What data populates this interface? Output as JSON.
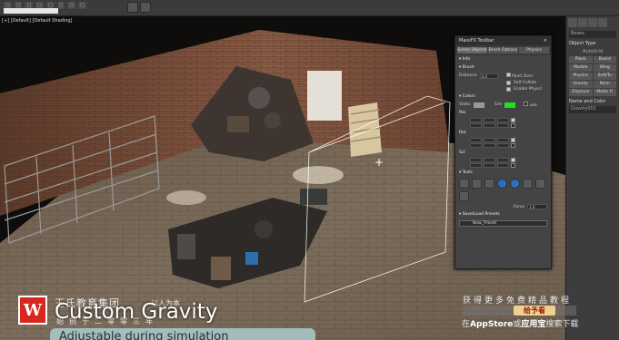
{
  "toolbar": {
    "menu_items": [
      "",
      "",
      "",
      "",
      "",
      "",
      "",
      ""
    ]
  },
  "viewport": {
    "label": "[+] [Default] [Default Shading]"
  },
  "massfx": {
    "title": "MassFX Toolbar",
    "tabs": [
      "Scene Objects",
      "Brush Options",
      "Physics"
    ],
    "sections": {
      "info": "Info",
      "brush": "Brush",
      "colors": "Colors",
      "pos": "Pos",
      "rot": "Rot",
      "scl": "Scl",
      "tools": "Tools",
      "saveload": "Save/Load Presets"
    },
    "brush": {
      "distance_label": "Distance",
      "distance_value": "0.0",
      "checks": [
        {
          "label": "Paint Over",
          "on": true
        },
        {
          "label": "Self Collide",
          "on": true
        },
        {
          "label": "Enable Physcl",
          "on": true
        }
      ]
    },
    "colors": {
      "static_label": "Static",
      "sim_label": "Sim",
      "use_label": "use",
      "static_color": "#9a9a9a",
      "sim_color": "#22e022"
    },
    "force_label": "Force",
    "force_value": "1.0",
    "preset_name": "New_Preset"
  },
  "command_panel": {
    "title": "Boxes",
    "object_type_label": "Object Type",
    "autogrid_label": "AutoGrid",
    "buttons": [
      "Plank",
      "Board",
      "Marble",
      "Wing",
      "Physics",
      "Soft/Tu",
      "Gravity",
      "Nsim",
      "Displace",
      "Motor Fi"
    ],
    "name_color_label": "Name and Color",
    "name_value": "Gravity001"
  },
  "overlay": {
    "brand_cn": "王氏教育集团",
    "slogan": "以人为本",
    "founded_cn": "始创于二零零三年",
    "title": "Custom Gravity",
    "subtitle": "Adjustable during simulation",
    "promo_line1": "获得更多免费精品教程",
    "promo_badge": "给予看",
    "promo_line3_pre": "在",
    "promo_appstore": "AppStore",
    "promo_or": "或",
    "promo_yingyongbao": "应用宝",
    "promo_suffix": "搜索下载"
  }
}
